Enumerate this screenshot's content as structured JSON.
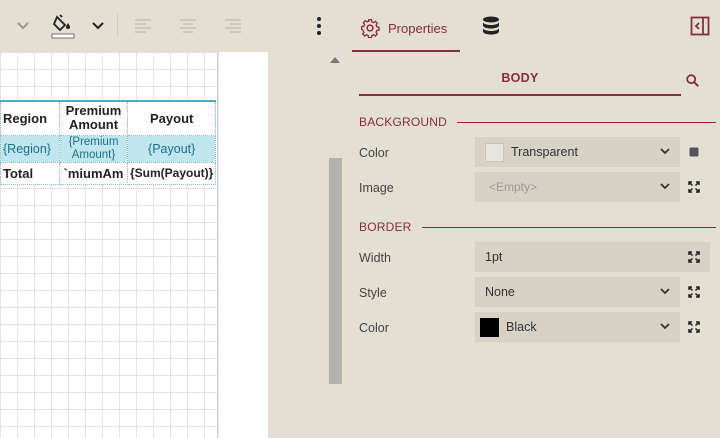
{
  "toolbar": {
    "icons": [
      "chevron-down-icon",
      "fill-color-icon",
      "chevron-down-icon",
      "align-left-icon",
      "align-center-icon",
      "align-right-icon",
      "more-vertical-icon"
    ]
  },
  "table": {
    "header": [
      "Region",
      "Premium Amount",
      "Payout"
    ],
    "data": [
      "{Region}",
      "{Premium Amount}",
      "{Payout}"
    ],
    "total": [
      "Total",
      "`miumAm",
      "{Sum(Payout)}"
    ]
  },
  "panel": {
    "tab_properties": "Properties",
    "body_title": "BODY",
    "sections": {
      "background": "BACKGROUND",
      "border": "BORDER"
    },
    "props": {
      "bg_color_label": "Color",
      "bg_color_value": "Transparent",
      "bg_image_label": "Image",
      "bg_image_value": "<Empty>",
      "border_width_label": "Width",
      "border_width_value": "1pt",
      "border_style_label": "Style",
      "border_style_value": "None",
      "border_color_label": "Color",
      "border_color_value": "Black"
    },
    "colors": {
      "accent": "#8b2c3a",
      "black_swatch": "#000000",
      "transparent_swatch": "#e8e5dd"
    }
  }
}
